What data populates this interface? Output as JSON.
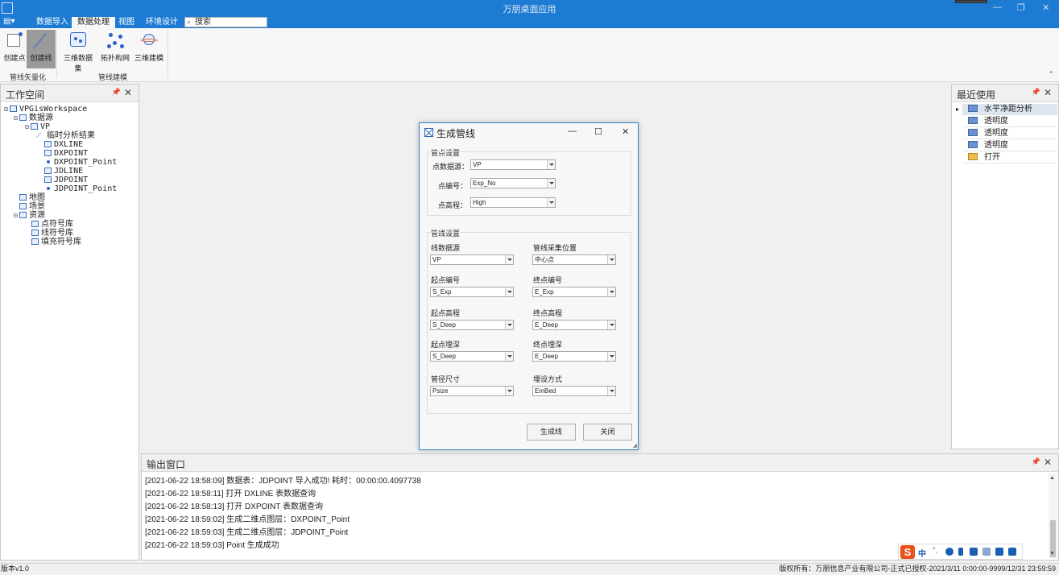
{
  "app": {
    "title": "万朋桌面应用"
  },
  "ribbon": {
    "tabs": [
      "数据导入",
      "数据处理",
      "视图",
      "环境设计"
    ],
    "active_tab": "数据处理",
    "search_placeholder": "搜索",
    "groups": [
      {
        "label": "管线矢量化",
        "buttons": [
          "创建点",
          "创建线"
        ]
      },
      {
        "label": "管线建模",
        "buttons": [
          "三维数据集",
          "拓扑构网",
          "三维建模"
        ]
      }
    ],
    "active_button": "创建线"
  },
  "workspace": {
    "title": "工作空间",
    "tree": [
      "VPGisWorkspace",
      "数据源",
      "VP",
      "临时分析结果",
      "DXLINE",
      "DXPOINT",
      "DXPOINT_Point",
      "JDLINE",
      "JDPOINT",
      "JDPOINT_Point",
      "地图",
      "场景",
      "资源",
      "点符号库",
      "线符号库",
      "填充符号库"
    ]
  },
  "recent": {
    "title": "最近使用",
    "items": [
      "水平净距分析",
      "透明度",
      "透明度",
      "透明度",
      "打开"
    ]
  },
  "output": {
    "title": "输出窗口",
    "lines": [
      "[2021-06-22 18:58:09] 数据表：JDPOINT 导入成功! 耗时：00:00:00.4097738",
      "[2021-06-22 18:58:11] 打开 DXLINE 表数据查询",
      "[2021-06-22 18:58:13] 打开 DXPOINT 表数据查询",
      "[2021-06-22 18:59:02] 生成二维点图层：DXPOINT_Point",
      "[2021-06-22 18:59:03] 生成二维点图层：JDPOINT_Point",
      "[2021-06-22 18:59:03] Point 生成成功"
    ]
  },
  "ime": {
    "mode": "中"
  },
  "status": {
    "left": "版本v1.0",
    "right": "版权所有：万朋信息产业有限公司-正式已授权-2021/3/11 0:00:00-9999/12/31 23:59:59"
  },
  "dialog": {
    "title": "生成管线",
    "point_group": {
      "title": "管点设置",
      "datasource_label": "点数据源：",
      "datasource": "VP",
      "id_label": "点编号：",
      "id": "Exp_No",
      "elev_label": "点高程：",
      "elev": "High"
    },
    "line_group": {
      "title": "管线设置",
      "line_source_label": "线数据源",
      "line_source": "VP",
      "collect_pos_label": "管线采集位置",
      "collect_pos": "中心点",
      "start_id_label": "起点编号",
      "start_id": "S_Exp",
      "end_id_label": "终点编号",
      "end_id": "E_Exp",
      "start_elev_label": "起点高程",
      "start_elev": "S_Deep",
      "end_elev_label": "终点高程",
      "end_elev": "E_Deep",
      "start_depth_label": "起点埋深",
      "start_depth": "S_Deep",
      "end_depth_label": "终点埋深",
      "end_depth": "E_Deep",
      "size_label": "管径尺寸",
      "size": "Psize",
      "lay_label": "埋设方式",
      "lay": "EmBed"
    },
    "generate_button": "生成线",
    "close_button": "关闭"
  }
}
